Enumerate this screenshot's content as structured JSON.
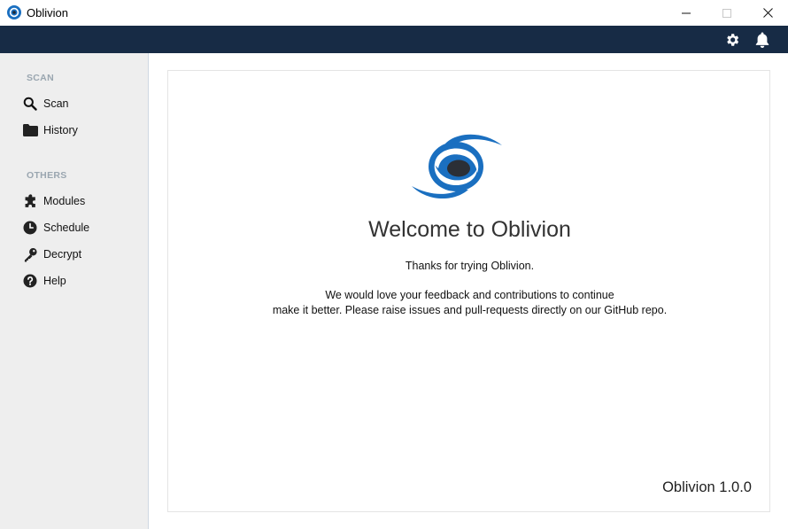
{
  "window": {
    "title": "Oblivion"
  },
  "toolbar": {
    "icons": [
      "gear-icon",
      "bell-icon"
    ]
  },
  "sidebar": {
    "sections": [
      {
        "heading": "SCAN",
        "items": [
          {
            "label": "Scan",
            "icon": "search-icon"
          },
          {
            "label": "History",
            "icon": "folder-icon"
          }
        ]
      },
      {
        "heading": "OTHERS",
        "items": [
          {
            "label": "Modules",
            "icon": "puzzle-icon"
          },
          {
            "label": "Schedule",
            "icon": "clock-icon"
          },
          {
            "label": "Decrypt",
            "icon": "key-icon"
          },
          {
            "label": "Help",
            "icon": "help-icon"
          }
        ]
      }
    ]
  },
  "main": {
    "welcome_title": "Welcome to Oblivion",
    "thanks_text": "Thanks for trying Oblivion.",
    "feedback_line1": "We would love your feedback and contributions to continue",
    "feedback_line2": "make it better. Please raise issues and pull-requests directly on our GitHub repo.",
    "version": "Oblivion 1.0.0"
  },
  "colors": {
    "toolbar_bg": "#172b45",
    "sidebar_bg": "#eeeeee",
    "section_heading": "#9aa6b0",
    "brand_blue": "#1a6fc0"
  }
}
